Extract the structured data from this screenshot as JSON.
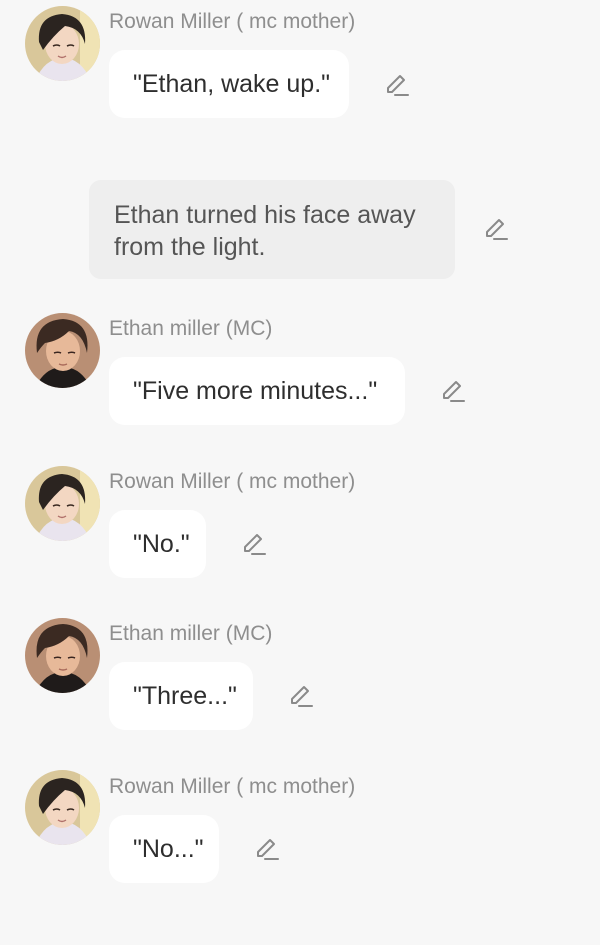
{
  "messages": [
    {
      "speaker": "Rowan Miller ( mc mother)",
      "avatar": "mother-avatar-icon",
      "text": "\"Ethan, wake up.\""
    },
    {
      "narration": "Ethan turned his face away from the light."
    },
    {
      "speaker": "Ethan miller (MC)",
      "avatar": "ethan-avatar-icon",
      "text": "\"Five more minutes...\""
    },
    {
      "speaker": "Rowan Miller ( mc mother)",
      "avatar": "mother-avatar-icon",
      "text": "\"No.\""
    },
    {
      "speaker": "Ethan miller (MC)",
      "avatar": "ethan-avatar-icon",
      "text": "\"Three...\""
    },
    {
      "speaker": "Rowan Miller ( mc mother)",
      "avatar": "mother-avatar-icon",
      "text": "\"No...\""
    }
  ],
  "icons": {
    "edit": "pencil-edit-icon"
  },
  "colors": {
    "background": "#f7f7f7",
    "bubble": "#ffffff",
    "narration_bubble": "#eeeeee",
    "name_text": "#8e8e8e",
    "message_text": "#2e2e2e",
    "icon": "#8a8a8a"
  }
}
